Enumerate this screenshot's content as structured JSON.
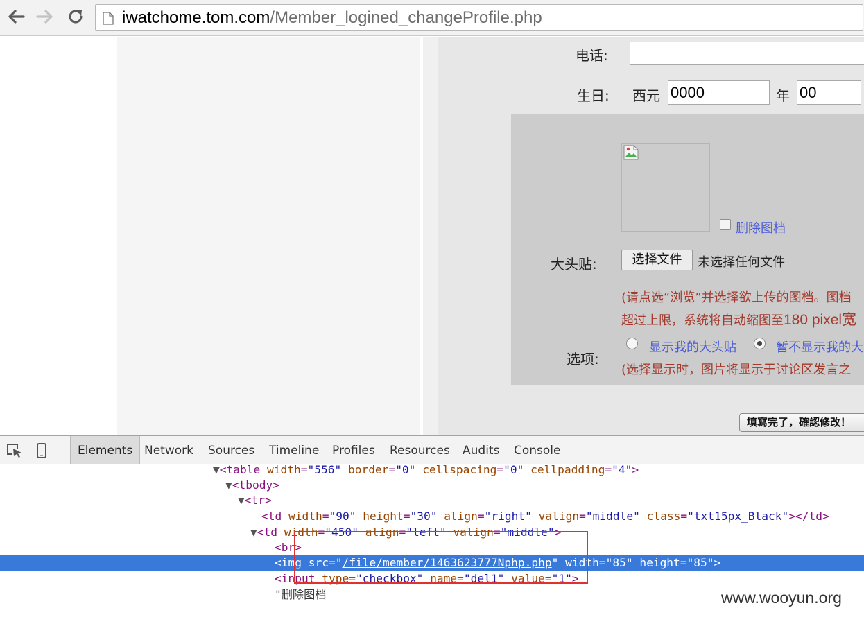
{
  "browser": {
    "url_host": "iwatchome.tom.com",
    "url_path": "/Member_logined_changeProfile.php"
  },
  "form": {
    "phone_label": "电话:",
    "phone_value": "",
    "birthday_label": "生日:",
    "era_label": "西元",
    "year_value": "0000",
    "year_unit": "年",
    "month_value": "00",
    "delete_image_label": "删除图档",
    "avatar_label": "大头贴:",
    "choose_file_label": "选择文件",
    "no_file_label": "未选择任何文件",
    "upload_note_line1": "(请点选“浏览”并选择欲上传的图档。图档",
    "upload_note_line2_a": "超过上限，系统将自动缩图至",
    "upload_note_line2_b": "180 pixel宽",
    "options_label": "选项:",
    "option_show": "显示我的大头贴",
    "option_hide": "暂不显示我的大",
    "option_selected": "hide",
    "options_note": "(选择显示时，图片将显示于讨论区发言之",
    "submit_label": "填寫完了，確認修改！"
  },
  "devtools": {
    "tabs": [
      "Elements",
      "Network",
      "Sources",
      "Timeline",
      "Profiles",
      "Resources",
      "Audits",
      "Console"
    ],
    "active_tab": "Elements",
    "dom": {
      "table_tag": "table",
      "table_width": "\"556\"",
      "table_border": "\"0\"",
      "table_cellspacing": "\"0\"",
      "table_cellpadding": "\"4\"",
      "tbody_tag": "tbody",
      "tr_tag": "tr",
      "td1_width": "\"90\"",
      "td1_height": "\"30\"",
      "td1_align": "\"right\"",
      "td1_valign": "\"middle\"",
      "td1_class": "\"txt15px_Black\"",
      "td2_width": "\"450\"",
      "td2_align": "\"left\"",
      "td2_valign": "\"middle\"",
      "br_tag": "br",
      "img_src": "/file/member/1463623777Nphp.php",
      "img_width": "\"85\"",
      "img_height": "\"85\"",
      "input_type": "\"checkbox\"",
      "input_name": "\"del1\"",
      "input_value": "\"1\"",
      "text_node": "\"删除图档"
    }
  },
  "watermark": "www.wooyun.org",
  "colors": {
    "selection": "#3879d9",
    "highlight_box": "#e03030",
    "note_text": "#a33a2e",
    "link": "#4a5bd6"
  }
}
